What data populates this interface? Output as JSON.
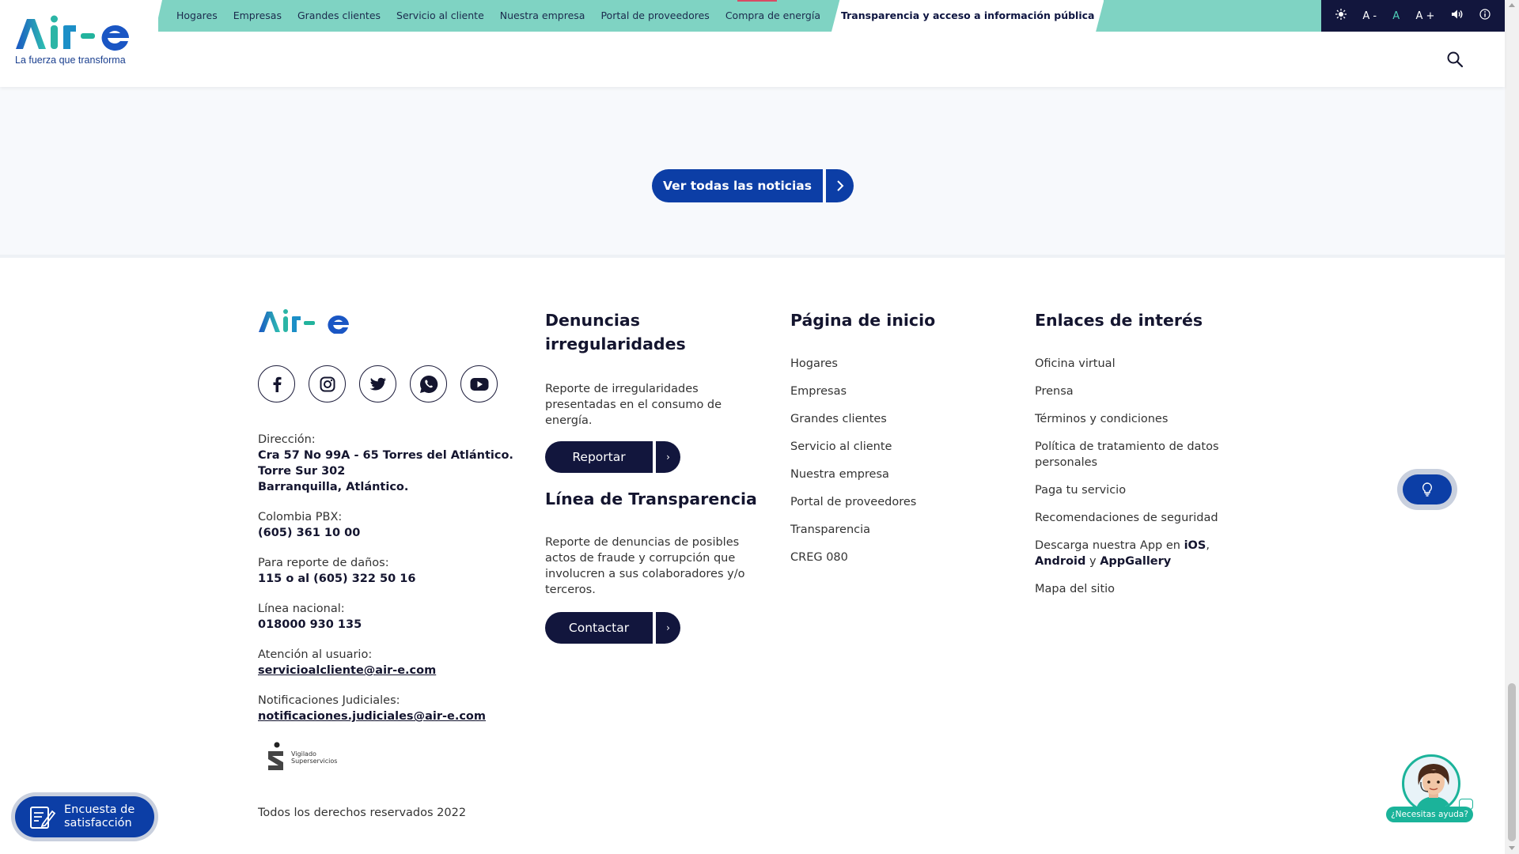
{
  "header": {
    "logo_alt": "Air-e",
    "tagline": "La fuerza que transforma",
    "nav": [
      {
        "label": "Hogares"
      },
      {
        "label": "Empresas"
      },
      {
        "label": "Grandes clientes"
      },
      {
        "label": "Servicio al cliente"
      },
      {
        "label": "Nuestra empresa"
      },
      {
        "label": "Portal de proveedores"
      },
      {
        "label": "Compra de energía"
      },
      {
        "label": "Transparencia y acceso a información pública",
        "active": true
      }
    ],
    "a11y": {
      "contrast_icon": "sun-icon",
      "font_decrease": "A -",
      "font_reset": "A",
      "font_increase": "A +",
      "audio_icon": "speaker-icon",
      "info_icon": "info-icon"
    },
    "search_icon": "search-icon"
  },
  "news": {
    "button_label": "Ver todas las noticias",
    "arrow_icon": "chevron-right-icon"
  },
  "footer": {
    "logo_alt": "Air-e",
    "social": [
      {
        "name": "facebook-icon"
      },
      {
        "name": "instagram-icon"
      },
      {
        "name": "twitter-icon"
      },
      {
        "name": "whatsapp-icon"
      },
      {
        "name": "youtube-icon"
      }
    ],
    "contact": {
      "address_label": "Dirección:",
      "address_line1": "Cra 57 No 99A - 65 Torres del Atlántico.",
      "address_line2": "Torre Sur 302",
      "address_line3": "Barranquilla, Atlántico.",
      "pbx_label": "Colombia PBX:",
      "pbx_value": "(605) 361 10 00",
      "damage_label": "Para reporte de daños:",
      "damage_value": "115 o al (605) 322 50 16",
      "national_label": "Línea nacional:",
      "national_value": "018000 930 135",
      "user_label": "Atención al usuario:",
      "user_email": "servicioalcliente@air-e.com",
      "judicial_label": "Notificaciones Judiciales:",
      "judicial_email": "notificaciones.judiciales@air-e.com"
    },
    "vigilado_line1": "Vigilado",
    "vigilado_line2": "Superservicios",
    "copyright": "Todos los derechos reservados 2022",
    "denuncias": {
      "title": "Denuncias irregularidades",
      "text": "Reporte de irregularidades presentadas en el consumo de energía.",
      "button": "Reportar",
      "arrow": "›"
    },
    "transparencia": {
      "title": "Línea de Transparencia",
      "text": "Reporte de denuncias de posibles actos de fraude y corrupción que involucren a sus colaboradores y/o terceros.",
      "button": "Contactar",
      "arrow": "›"
    },
    "inicio": {
      "title": "Página de inicio",
      "links": [
        "Hogares",
        "Empresas",
        "Grandes clientes",
        "Servicio al cliente",
        "Nuestra empresa",
        "Portal de proveedores",
        "Transparencia",
        "CREG 080"
      ]
    },
    "enlaces": {
      "title": "Enlaces de interés",
      "links": [
        "Oficina virtual",
        "Prensa",
        "Términos y condiciones",
        "Política de tratamiento de datos personales",
        "Paga tu servicio",
        "Recomendaciones de seguridad"
      ],
      "app_prefix": "Descarga nuestra App en ",
      "app_ios": "iOS",
      "app_comma": ",",
      "app_android": "Android",
      "app_y": " y ",
      "app_gallery": "AppGallery",
      "sitemap": "Mapa del sitio"
    }
  },
  "floating": {
    "bulb_icon": "lightbulb-icon",
    "survey_label_1": "Encuesta de",
    "survey_label_2": "satisfacción",
    "survey_icon": "edit-document-icon",
    "help_label": "¿Necesitas ayuda?"
  },
  "colors": {
    "topbar": "#7fd3c3",
    "navy": "#12163d",
    "blue": "#0c3ea6",
    "teal": "#1bb39a"
  }
}
